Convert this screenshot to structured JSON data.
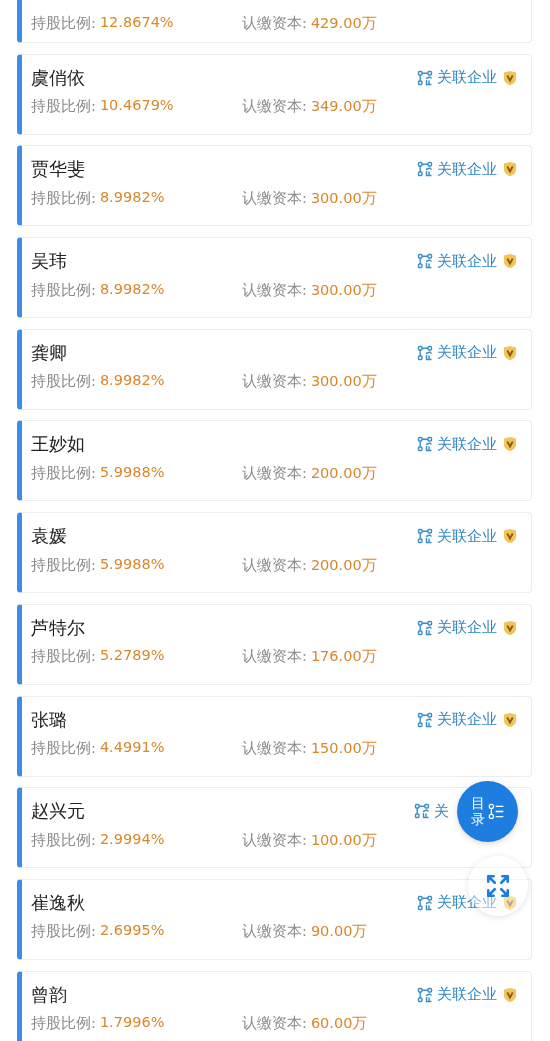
{
  "shareholders": [
    {
      "kind": "partial",
      "ratio_label": "持股比例:",
      "ratio": "12.8674%",
      "capital_label": "认缴资本:",
      "capital": "429.00万"
    },
    {
      "kind": "full",
      "name": "虞俏依",
      "link": "关联企业",
      "ratio_label": "持股比例:",
      "ratio": "10.4679%",
      "capital_label": "认缴资本:",
      "capital": "349.00万"
    },
    {
      "kind": "full",
      "name": "贾华斐",
      "link": "关联企业",
      "ratio_label": "持股比例:",
      "ratio": "8.9982%",
      "capital_label": "认缴资本:",
      "capital": "300.00万"
    },
    {
      "kind": "full",
      "name": "吴玮",
      "link": "关联企业",
      "ratio_label": "持股比例:",
      "ratio": "8.9982%",
      "capital_label": "认缴资本:",
      "capital": "300.00万"
    },
    {
      "kind": "full",
      "name": "龚卿",
      "link": "关联企业",
      "ratio_label": "持股比例:",
      "ratio": "8.9982%",
      "capital_label": "认缴资本:",
      "capital": "300.00万"
    },
    {
      "kind": "full",
      "name": "王妙如",
      "link": "关联企业",
      "ratio_label": "持股比例:",
      "ratio": "5.9988%",
      "capital_label": "认缴资本:",
      "capital": "200.00万"
    },
    {
      "kind": "full",
      "name": "袁媛",
      "link": "关联企业",
      "ratio_label": "持股比例:",
      "ratio": "5.9988%",
      "capital_label": "认缴资本:",
      "capital": "200.00万"
    },
    {
      "kind": "full",
      "name": "芦特尔",
      "link": "关联企业",
      "ratio_label": "持股比例:",
      "ratio": "5.2789%",
      "capital_label": "认缴资本:",
      "capital": "176.00万"
    },
    {
      "kind": "full",
      "name": "张璐",
      "link": "关联企业",
      "ratio_label": "持股比例:",
      "ratio": "4.4991%",
      "capital_label": "认缴资本:",
      "capital": "150.00万"
    },
    {
      "kind": "full",
      "name": "赵兴元",
      "link": "关",
      "verified": false,
      "ratio_label": "持股比例:",
      "ratio": "2.9994%",
      "capital_label": "认缴资本:",
      "capital": "100.00万"
    },
    {
      "kind": "full",
      "name": "崔逸秋",
      "link": "关联企业",
      "ratio_label": "持股比例:",
      "ratio": "2.6995%",
      "capital_label": "认缴资本:",
      "capital": "90.00万"
    },
    {
      "kind": "full",
      "name": "曾韵",
      "link": "关联企业",
      "ratio_label": "持股比例:",
      "ratio": "1.7996%",
      "capital_label": "认缴资本:",
      "capital": "60.00万"
    }
  ],
  "toc_button": {
    "label": "目录"
  }
}
